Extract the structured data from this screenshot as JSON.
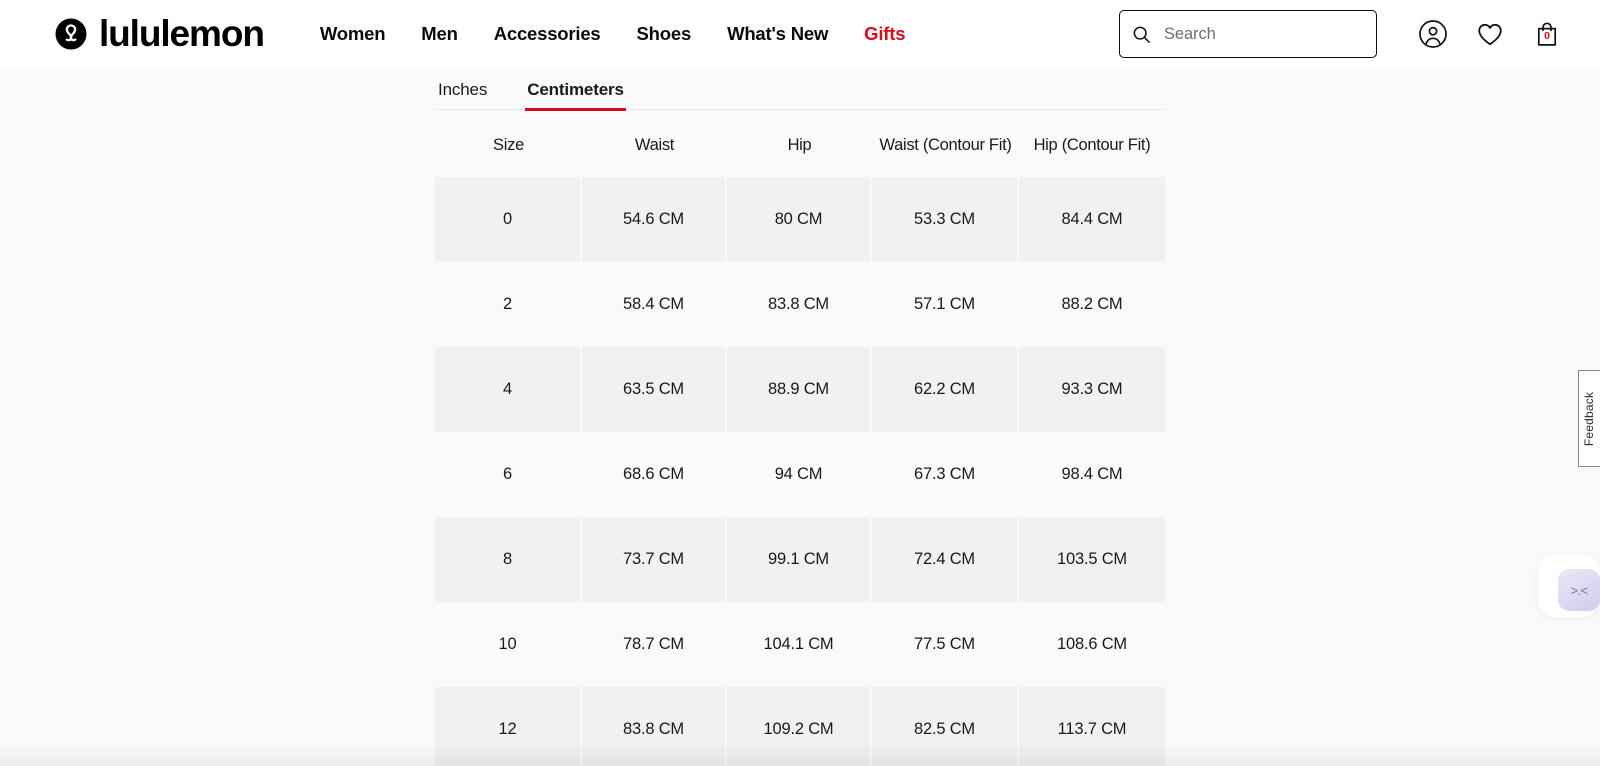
{
  "header": {
    "brand": {
      "name": "lululemon",
      "logo_icon": "lululemon-omega-logo"
    },
    "nav": [
      {
        "label": "Women",
        "accent": false
      },
      {
        "label": "Men",
        "accent": false
      },
      {
        "label": "Accessories",
        "accent": false
      },
      {
        "label": "Shoes",
        "accent": false
      },
      {
        "label": "What's New",
        "accent": false
      },
      {
        "label": "Gifts",
        "accent": true
      }
    ],
    "search": {
      "placeholder": "Search",
      "value": "",
      "icon": "search-icon"
    },
    "account_icon": "account-circle-icon",
    "wishlist_icon": "heart-icon",
    "bag_icon": "shopping-bag-icon",
    "bag_count": "0",
    "accent_color": "#d80c18"
  },
  "size_chart": {
    "tabs": [
      {
        "label": "Inches",
        "active": false
      },
      {
        "label": "Centimeters",
        "active": true
      }
    ],
    "columns": [
      "Size",
      "Waist",
      "Hip",
      "Waist (Contour Fit)",
      "Hip (Contour Fit)"
    ],
    "rows": [
      {
        "size": "0",
        "waist": "54.6 CM",
        "hip": "80 CM",
        "waist_cf": "53.3 CM",
        "hip_cf": "84.4 CM"
      },
      {
        "size": "2",
        "waist": "58.4 CM",
        "hip": "83.8 CM",
        "waist_cf": "57.1 CM",
        "hip_cf": "88.2 CM"
      },
      {
        "size": "4",
        "waist": "63.5 CM",
        "hip": "88.9 CM",
        "waist_cf": "62.2 CM",
        "hip_cf": "93.3 CM"
      },
      {
        "size": "6",
        "waist": "68.6 CM",
        "hip": "94 CM",
        "waist_cf": "67.3 CM",
        "hip_cf": "98.4 CM"
      },
      {
        "size": "8",
        "waist": "73.7 CM",
        "hip": "99.1 CM",
        "waist_cf": "72.4 CM",
        "hip_cf": "103.5 CM"
      },
      {
        "size": "10",
        "waist": "78.7 CM",
        "hip": "104.1 CM",
        "waist_cf": "77.5 CM",
        "hip_cf": "108.6 CM"
      },
      {
        "size": "12",
        "waist": "83.8 CM",
        "hip": "109.2 CM",
        "waist_cf": "82.5 CM",
        "hip_cf": "113.7 CM"
      }
    ]
  },
  "widgets": {
    "feedback_label": "Feedback",
    "chat_face": "&gt;.&lt;",
    "chat_face_text": ">.<"
  }
}
